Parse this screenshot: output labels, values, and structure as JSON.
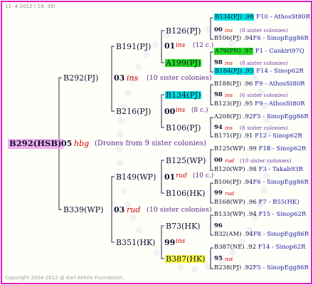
{
  "header": "11-  4-2012 ( 18: 38)",
  "footer": "Copyright 2004-2012 @ Karl Kehrle Foundation.",
  "root": "B292(HSB)",
  "root_num": "05",
  "root_tag": "hbg",
  "root_note": "(Drones from 9 sister colonies)",
  "g1": {
    "top": {
      "name": "B292(PJ)",
      "num": "03",
      "tag": "ins",
      "note": "(10 sister colonies)"
    },
    "bottom": {
      "name": "B339(WP)",
      "num": "03",
      "tag": "rud",
      "note": "(10 sister colonies)"
    }
  },
  "g2": {
    "a": {
      "name": "B191(PJ)",
      "num": "01",
      "tag": "ins",
      "note": "(12 c.)"
    },
    "b": {
      "name": "B216(PJ)",
      "num": "00",
      "tag": "ins",
      "note": "(8 c.)"
    },
    "c": {
      "name": "B149(WP)",
      "num": "01",
      "tag": "rud",
      "note": "(10 c.)"
    },
    "d": {
      "name": "B351(HK)",
      "num": "99",
      "tag": "ins"
    }
  },
  "g3": [
    {
      "name": "B126(PJ)",
      "num": "00",
      "tag": "ins",
      "note": "(8 sister colonies)",
      "top": {
        "name": "B134(PJ)",
        "code": ".98",
        "loc": "F10 - AthosSt80R"
      },
      "bot": {
        "name": "B106(PJ)",
        "code": ".94",
        "loc": "F6 - SinopEgg86R"
      }
    },
    {
      "name": "A199(PJ)",
      "num": "98",
      "tag": "ins",
      "note": "(8 sister colonies)",
      "top": {
        "name": "A79(PN)",
        "code": ".97",
        "loc": "F1 - Cankiri97Q"
      },
      "bot": {
        "name": "B184(PJ)",
        "code": ".95",
        "loc": "F14 - Sinop62R"
      }
    },
    {
      "name": "B134(PJ)",
      "num": "98",
      "tag": "ins",
      "note": "(6 sister colonies)",
      "top": {
        "name": "B188(PJ)",
        "code": ".96",
        "loc": "F9 - AthosSt80R"
      },
      "bot": {
        "name": "B123(PJ)",
        "code": ".95",
        "loc": "F9 - AthosSt80R"
      }
    },
    {
      "name": "B106(PJ)",
      "num": "94",
      "tag": "ins",
      "note": "(8 sister colonies)",
      "top": {
        "name": "A208(PJ)",
        "code": ".92",
        "loc": "F5 - SinopEgg86R"
      },
      "bot": {
        "name": "B171(PJ)",
        "code": ".91",
        "loc": "F12 - Sinop62R"
      }
    },
    {
      "name": "B125(WP)",
      "num": "00",
      "tag": "rud",
      "note": "(10 sister colonies)",
      "top": {
        "name": "B125(WP)",
        "code": ".99",
        "loc": "F18 - Sinop62R"
      },
      "bot": {
        "name": "B120(WP)",
        "code": ".98",
        "loc": "F3 - Takab93R"
      }
    },
    {
      "name": "B106(HK)",
      "num": "99",
      "tag": "rud",
      "note": "",
      "top": {
        "name": "B106(PJ)",
        "code": ".94",
        "loc": "F6 - SinopEgg86R"
      },
      "bot": {
        "name": "B168(WP)",
        "code": ".96",
        "loc": "F7 - B55(HK)"
      }
    },
    {
      "name": "B73(HK)",
      "num": "96",
      "tag": "",
      "note": "",
      "top": {
        "name": "B133(WP)",
        "code": ".94",
        "loc": "F15 - Sinop62R"
      },
      "bot": {
        "name": "B32(AM)",
        "code": ".94",
        "loc": "F8 - SinopEgg86R"
      }
    },
    {
      "name": "B387(HK)",
      "num": "95",
      "tag": "nst",
      "note": "",
      "top": {
        "name": "B387(NE)",
        "code": ".92",
        "loc": "F14 - Sinop62R"
      },
      "bot": {
        "name": "B238(PJ)",
        "code": ".92",
        "loc": "F5 - SinopEgg86R"
      }
    }
  ]
}
